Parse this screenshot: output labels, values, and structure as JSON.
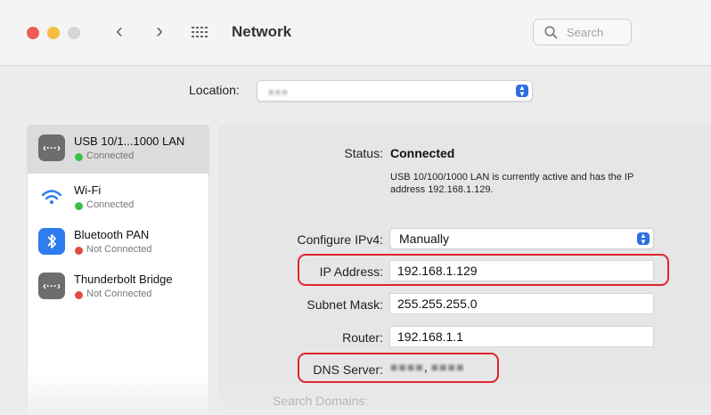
{
  "window": {
    "title": "Network",
    "search_placeholder": "Search",
    "icons": [
      "close-light",
      "minimize-light",
      "zoom-light",
      "back-chevron-icon",
      "forward-chevron-icon",
      "grid-icon",
      "search-icon"
    ]
  },
  "location": {
    "label": "Location:",
    "value": "■■■"
  },
  "sidebar": {
    "services": [
      {
        "name": "USB 10/1...1000 LAN",
        "status": "Connected",
        "status_color": "#3dbf4a",
        "icon": "ethernet-icon",
        "selected": true
      },
      {
        "name": "Wi-Fi",
        "status": "Connected",
        "status_color": "#3dbf4a",
        "icon": "wifi-icon",
        "selected": false
      },
      {
        "name": "Bluetooth PAN",
        "status": "Not Connected",
        "status_color": "#e34a43",
        "icon": "bluetooth-icon",
        "selected": false
      },
      {
        "name": "Thunderbolt Bridge",
        "status": "Not Connected",
        "status_color": "#e34a43",
        "icon": "ethernet-icon",
        "selected": false
      }
    ]
  },
  "details": {
    "status_label": "Status:",
    "status_value": "Connected",
    "status_description": "USB 10/100/1000 LAN is currently active and has the IP address 192.168.1.129.",
    "configure_label": "Configure IPv4:",
    "configure_value": "Manually",
    "ip_label": "IP Address:",
    "ip_value": "192.168.1.129",
    "subnet_label": "Subnet Mask:",
    "subnet_value": "255.255.255.0",
    "router_label": "Router:",
    "router_value": "192.168.1.1",
    "dns_label": "DNS Server:",
    "dns_value_1": "■■■■",
    "dns_separator": ",",
    "dns_value_2": "■■■■",
    "search_domains_label": "Search Domains:"
  },
  "colors": {
    "accent": "#2d6fe0",
    "callout": "#e0242b"
  }
}
